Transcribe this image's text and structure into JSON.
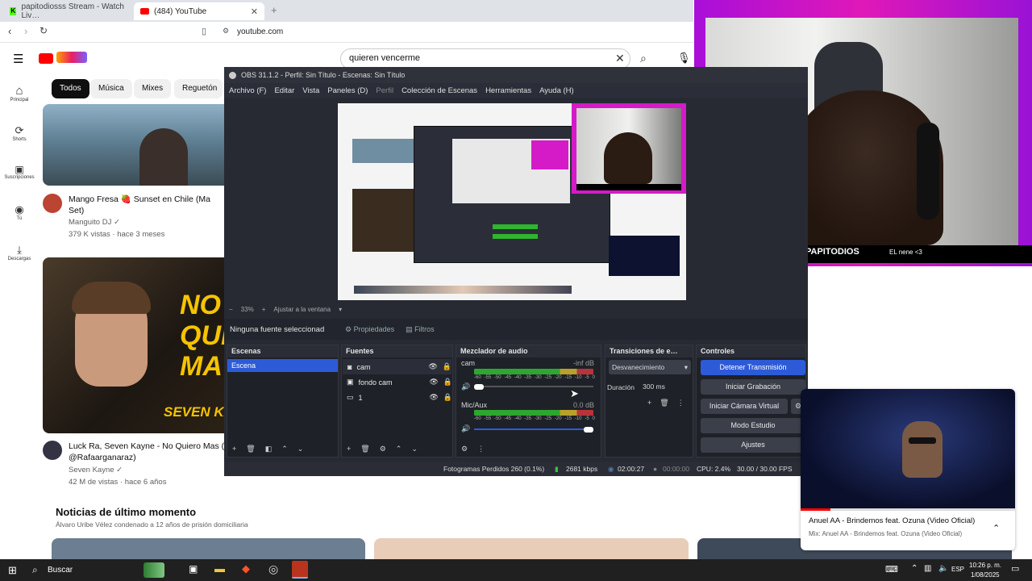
{
  "browser": {
    "tabs": [
      {
        "label": "papitodiosss Stream - Watch Liv…"
      },
      {
        "label": "(484) YouTube"
      }
    ],
    "url": "youtube.com"
  },
  "youtube": {
    "search_value": "quieren vencerme",
    "sidebar": [
      {
        "label": "Principal",
        "icon": "home-icon"
      },
      {
        "label": "Shorts",
        "icon": "shorts-icon"
      },
      {
        "label": "Suscripciones",
        "icon": "subscriptions-icon"
      },
      {
        "label": "Tú",
        "icon": "user-icon"
      },
      {
        "label": "Descargas",
        "icon": "download-icon"
      }
    ],
    "chips": [
      "Todos",
      "Música",
      "Mixes",
      "Reguetón"
    ],
    "video1": {
      "title1": "Mango Fresa 🍓 Sunset en Chile ",
      "title_cut": "(Ma",
      "title2": "Set)",
      "channel": "Manguito DJ",
      "meta": "379 K vistas · hace 3 meses"
    },
    "video2": {
      "title1": "Luck Ra, Seven Kayne - No Quiero Mas (",
      "title2": "@Rafaarganaraz)",
      "channel": "Seven Kayne",
      "meta": "42 M de vistas · hace 6 años",
      "thumb_text": [
        "NO",
        "QUIE",
        "MA",
        "SEVEN KAYNE"
      ]
    },
    "news": {
      "title": "Noticias de último momento",
      "subtitle": "Álvaro Uribe Vélez condenado a 12 años de prisión domiciliaria"
    }
  },
  "obs": {
    "title": "OBS 31.1.2 - Perfil: Sin Título - Escenas: Sin Título",
    "menu": [
      "Archivo (F)",
      "Editar",
      "Vista",
      "Paneles (D)",
      "Perfil",
      "Colección de Escenas",
      "Herramientas",
      "Ayuda (H)"
    ],
    "zoom": "33%",
    "fit": "Ajustar a la ventana",
    "no_source": "Ninguna fuente seleccionad",
    "props": "Propiedades",
    "filters": "Filtros",
    "scenes_title": "Escenas",
    "scene": "Escena",
    "sources_title": "Fuentes",
    "sources": [
      "cam",
      "fondo cam",
      "1"
    ],
    "mixer_title": "Mezclador de audio",
    "ch1": {
      "name": "cam",
      "db": "-inf dB"
    },
    "ch2": {
      "name": "Mic/Aux",
      "db": "0.0 dB"
    },
    "scale": [
      "-60",
      "-55",
      "-50",
      "-45",
      "-40",
      "-35",
      "-30",
      "-25",
      "-20",
      "-15",
      "-10",
      "-5",
      "0"
    ],
    "trans_title": "Transiciones de e…",
    "transition": "Desvanecimiento",
    "duration_label": "Duración",
    "duration": "300 ms",
    "controls_title": "Controles",
    "controls": [
      "Detener Transmisión",
      "Iniciar Grabación",
      "Iniciar Cámara Virtual",
      "Modo Estudio",
      "Ajustes"
    ],
    "status": {
      "dropped": "Fotogramas Perdidos 260 (0.1%)",
      "kbps": "2681 kbps",
      "live": "02:00:27",
      "rec": "00:00:00",
      "cpu": "CPU: 2.4%",
      "fps": "30.00 / 30.00 FPS"
    }
  },
  "overlay": {
    "name": "PAPITODIOS",
    "tag": "EL nene <3"
  },
  "music": {
    "title": "Anuel AA - Brindemos feat. Ozuna (Video Oficial)",
    "sub": "Mix: Anuel AA - Brindemos feat. Ozuna (Video Oficial)"
  },
  "taskbar": {
    "search": "Buscar",
    "time": "10:26 p. m.",
    "date": "1/08/2025",
    "lang": "ESP"
  },
  "colors": {
    "obs_bg": "#272a33",
    "accent_blue": "#2d5bd8",
    "youtube_red": "#ff0000",
    "overlay_magenta": "#d714c2"
  }
}
